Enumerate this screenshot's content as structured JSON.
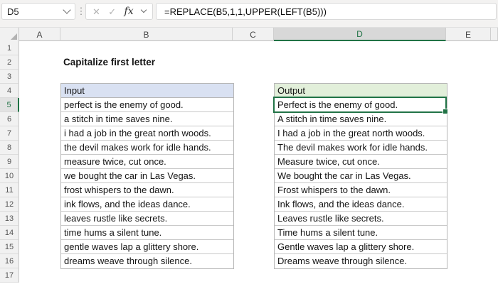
{
  "formula_bar": {
    "name_box": "D5",
    "fx_label": "fx",
    "formula": "=REPLACE(B5,1,1,UPPER(LEFT(B5)))"
  },
  "sheet": {
    "title": "Capitalize first letter",
    "column_headers": [
      "A",
      "B",
      "C",
      "D",
      "E"
    ],
    "selected_cell": "D5",
    "selected_column": "D",
    "selected_row": 5,
    "row_numbers": [
      1,
      2,
      3,
      4,
      5,
      6,
      7,
      8,
      9,
      10,
      11,
      12,
      13,
      14,
      15,
      16,
      17
    ],
    "input_header": "Input",
    "output_header": "Output",
    "input_values": [
      "perfect is the enemy of good.",
      "a stitch in time saves nine.",
      "i had a job in the great north woods.",
      "the devil makes work for idle hands.",
      "measure twice, cut once.",
      "we bought the car in Las Vegas.",
      "frost whispers to the dawn.",
      "ink flows, and the ideas dance.",
      "leaves rustle like secrets.",
      "time hums a silent tune.",
      "gentle waves lap a glittery shore.",
      "dreams weave through silence."
    ],
    "output_values": [
      "Perfect is the enemy of good.",
      "A stitch in time saves nine.",
      "I had a job in the great north woods.",
      "The devil makes work for idle hands.",
      "Measure twice, cut once.",
      "We bought the car in Las Vegas.",
      "Frost whispers to the dawn.",
      "Ink flows, and the ideas dance.",
      "Leaves rustle like secrets.",
      "Time hums a silent tune.",
      "Gentle waves lap a glittery shore.",
      "Dreams weave through silence."
    ]
  },
  "colors": {
    "selection_green": "#217346",
    "input_header_fill": "#D9E1F2",
    "output_header_fill": "#E2EFDA",
    "table_border": "#b7b7b7"
  }
}
